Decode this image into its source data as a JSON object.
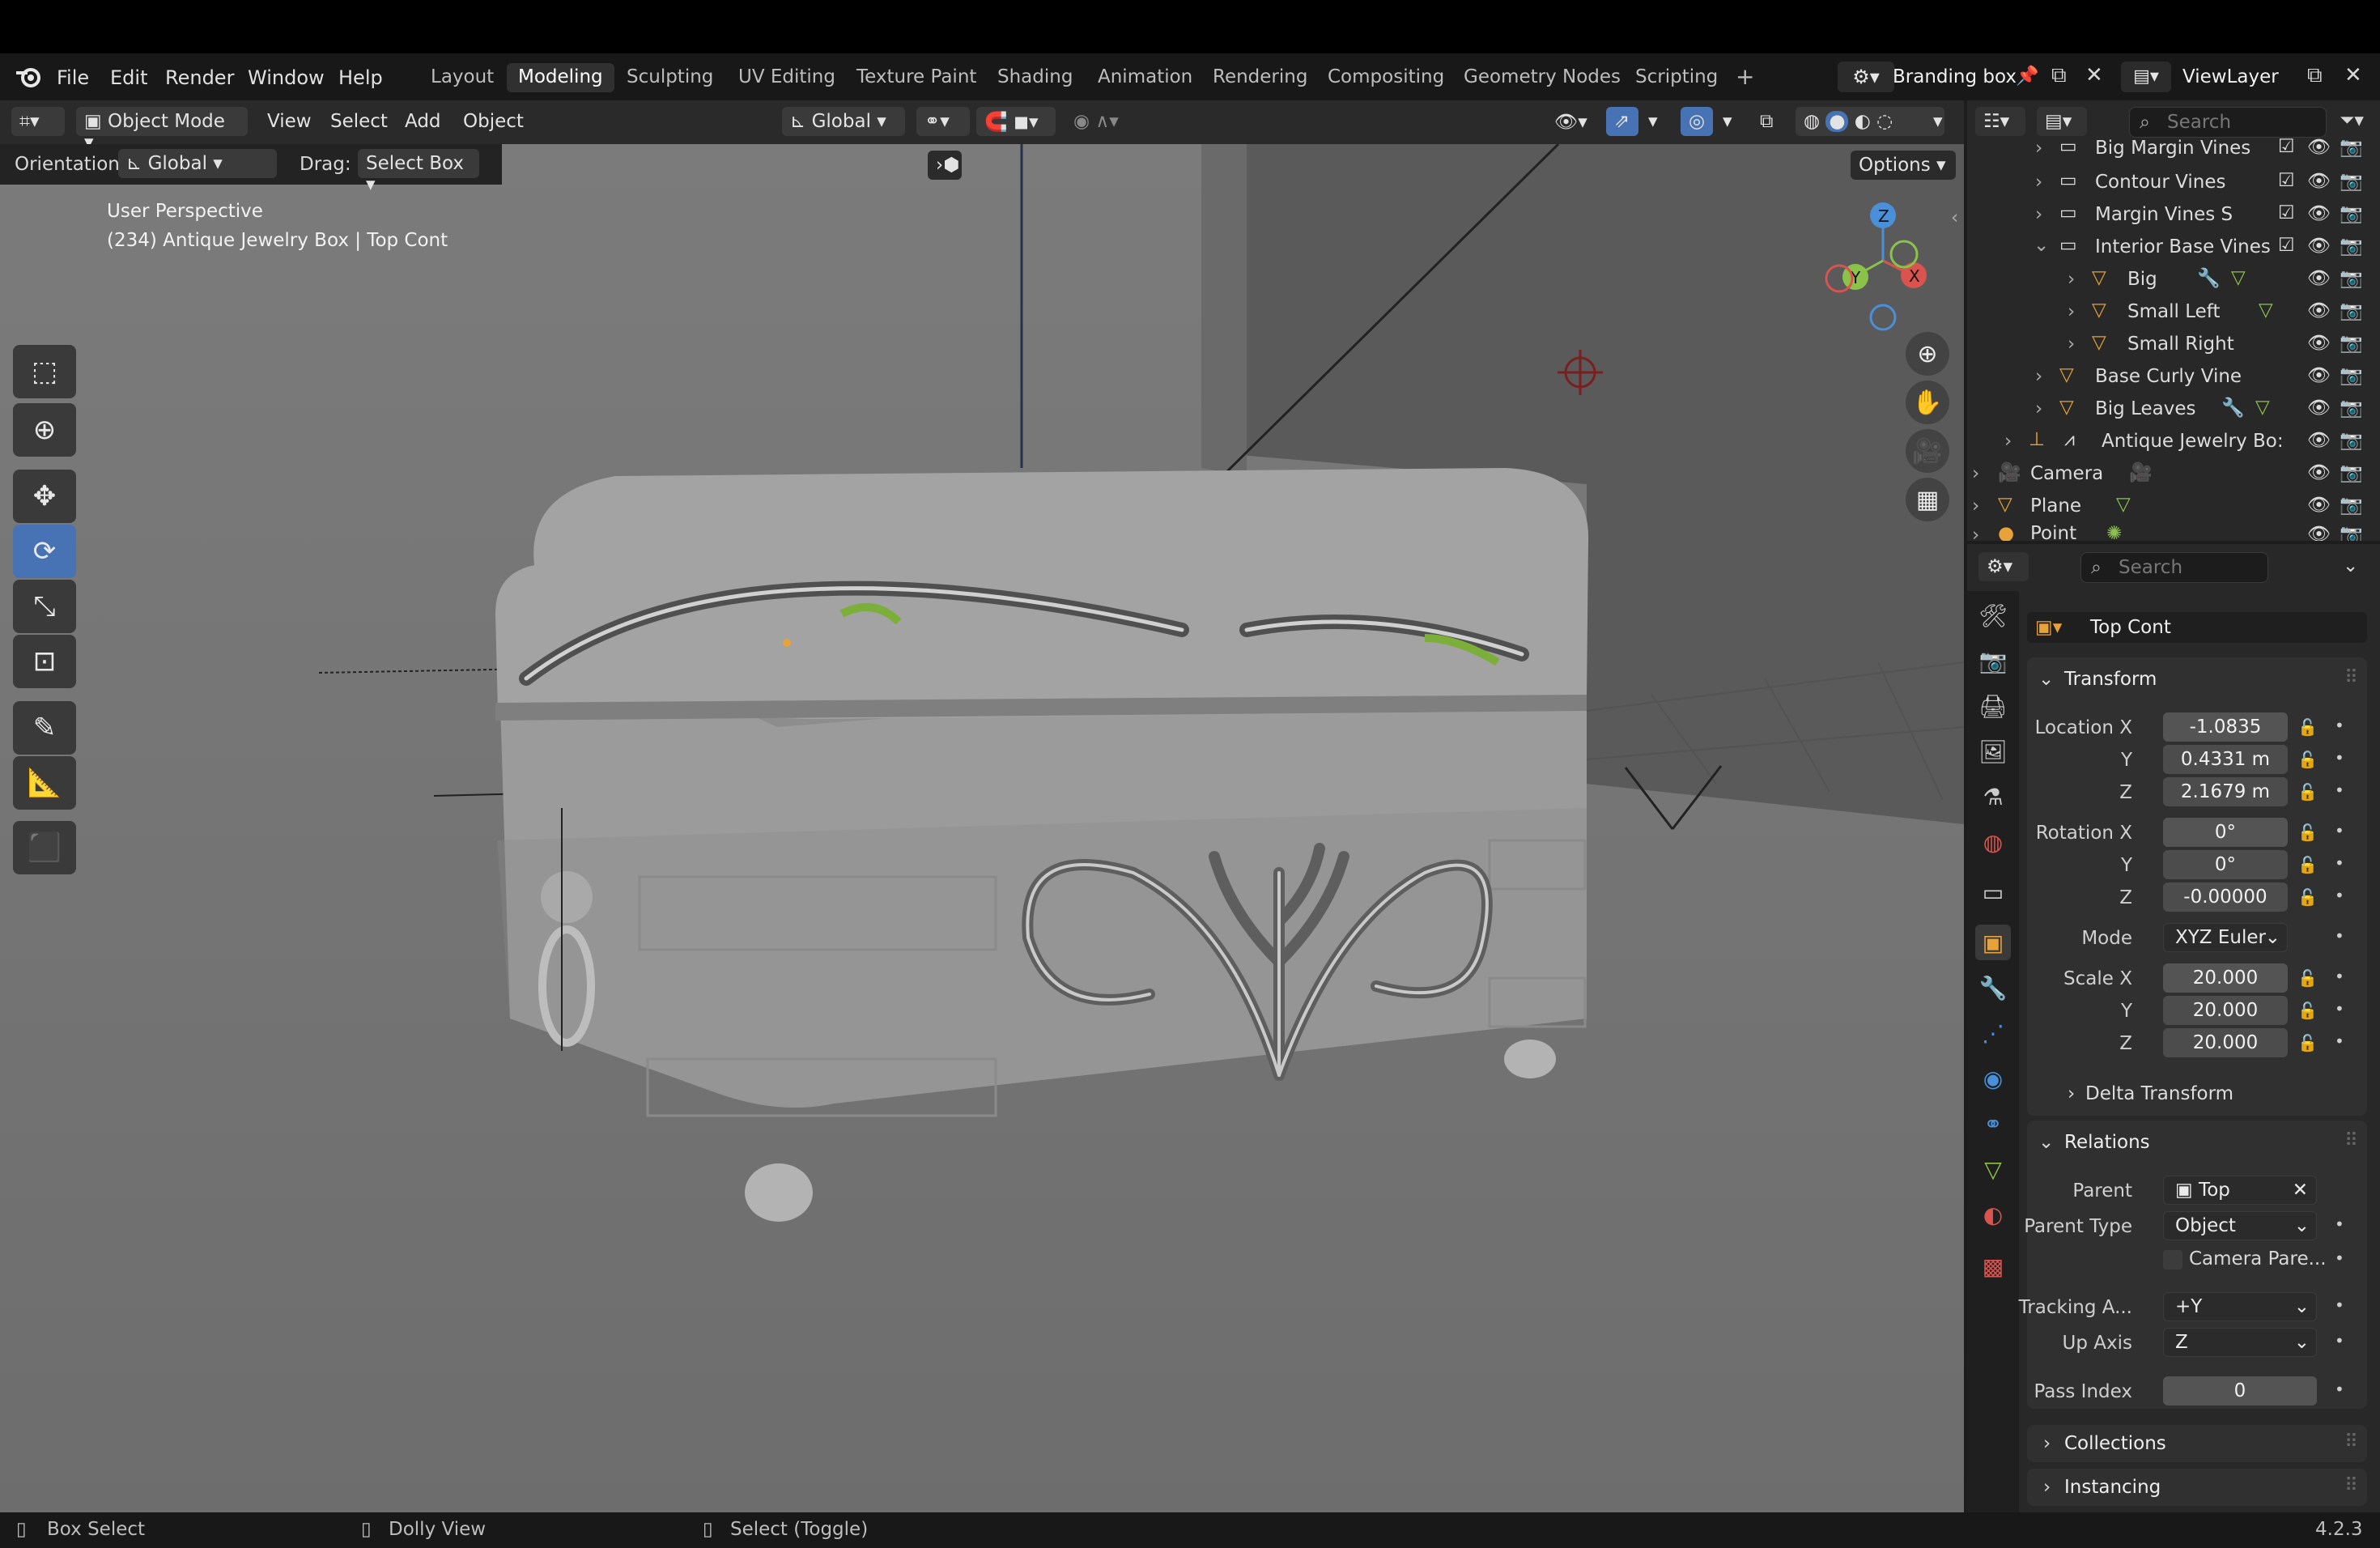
{
  "menu": {
    "file": "File",
    "edit": "Edit",
    "render": "Render",
    "window": "Window",
    "help": "Help"
  },
  "workspaces": [
    "Layout",
    "Modeling",
    "Sculpting",
    "UV Editing",
    "Texture Paint",
    "Shading",
    "Animation",
    "Rendering",
    "Compositing",
    "Geometry Nodes",
    "Scripting"
  ],
  "scene_name": "Branding box",
  "view_layer": "ViewLayer",
  "header": {
    "mode": "Object Mode",
    "view": "View",
    "select": "Select",
    "add": "Add",
    "object": "Object",
    "transform_orientation": "Global"
  },
  "subheader": {
    "orientation_label": "Orientation:",
    "orientation_value": "Global",
    "drag_label": "Drag:",
    "drag_value": "Select Box",
    "options": "Options"
  },
  "viewport": {
    "perspective": "User Perspective",
    "object_info": "(234) Antique Jewelry Box | Top Cont"
  },
  "outliner": {
    "search_placeholder": "Search",
    "rows": [
      {
        "label": "Big Margin Vines"
      },
      {
        "label": "Contour Vines"
      },
      {
        "label": "Margin Vines S"
      },
      {
        "label": "Interior Base Vines"
      },
      {
        "label": "Big"
      },
      {
        "label": "Small Left"
      },
      {
        "label": "Small Right"
      },
      {
        "label": "Base Curly Vine"
      },
      {
        "label": "Big Leaves"
      },
      {
        "label": "Antique Jewelry Bo:"
      },
      {
        "label": "Camera"
      },
      {
        "label": "Plane"
      },
      {
        "label": "Point"
      }
    ]
  },
  "properties": {
    "search_placeholder": "Search",
    "object_name": "Top Cont",
    "transform": {
      "title": "Transform",
      "location_label": "Location X",
      "loc_x": "-1.0835",
      "loc_y": "0.4331 m",
      "loc_z": "2.1679 m",
      "rotation_label": "Rotation X",
      "rot_x": "0°",
      "rot_y": "0°",
      "rot_z": "-0.00000",
      "mode_label": "Mode",
      "mode_value": "XYZ Euler",
      "scale_label": "Scale X",
      "scale_x": "20.000",
      "scale_y": "20.000",
      "scale_z": "20.000",
      "y_label": "Y",
      "z_label": "Z",
      "delta": "Delta Transform"
    },
    "relations": {
      "title": "Relations",
      "parent_label": "Parent",
      "parent_value": "Top",
      "parent_type_label": "Parent Type",
      "parent_type_value": "Object",
      "camera_parent": "Camera Pare...",
      "tracking_label": "Tracking A...",
      "tracking_value": "+Y",
      "up_axis_label": "Up Axis",
      "up_axis_value": "Z",
      "pass_index_label": "Pass Index",
      "pass_index_value": "0"
    },
    "collections": "Collections",
    "instancing": "Instancing"
  },
  "status": {
    "box_select": "Box Select",
    "dolly_view": "Dolly View",
    "select_toggle": "Select (Toggle)",
    "version": "4.2.3"
  },
  "colors": {
    "accent": "#4772b3",
    "axis_x": "#d9534f",
    "axis_y": "#8bc34a",
    "axis_z": "#4a90d9",
    "orange": "#e8a23a"
  }
}
